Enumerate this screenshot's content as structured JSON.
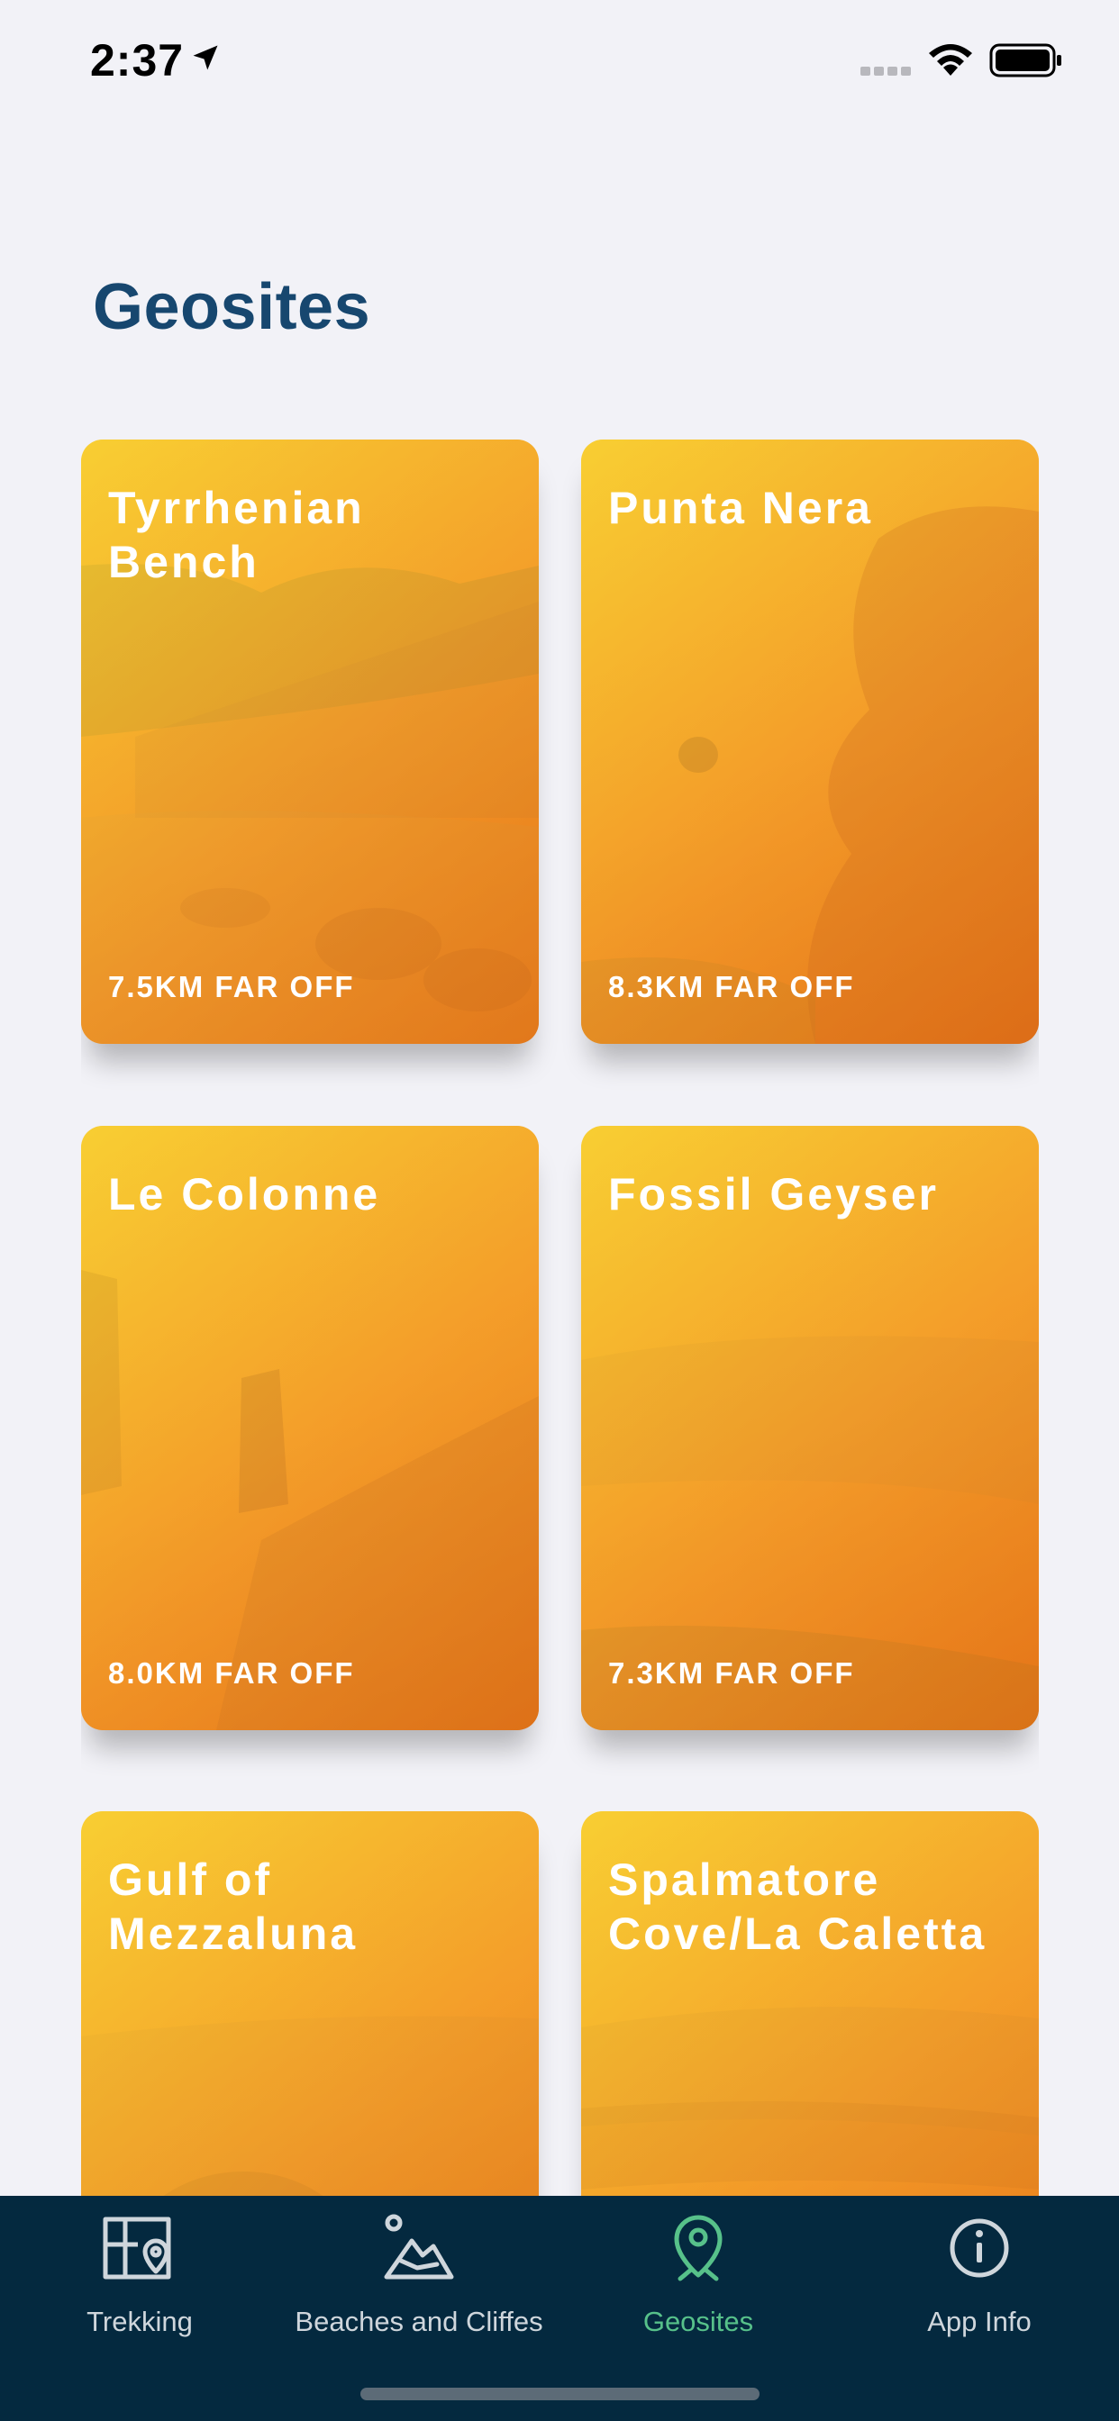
{
  "status_bar": {
    "time": "2:37"
  },
  "page": {
    "title": "Geosites"
  },
  "cards": [
    {
      "title": "Tyrrhenian Bench",
      "distance": "7.5KM FAR OFF"
    },
    {
      "title": "Punta Nera",
      "distance": "8.3KM FAR OFF"
    },
    {
      "title": "Le Colonne",
      "distance": "8.0KM FAR OFF"
    },
    {
      "title": "Fossil Geyser",
      "distance": "7.3KM FAR OFF"
    },
    {
      "title": "Gulf of Mezzaluna",
      "distance": ""
    },
    {
      "title": "Spalmatore Cove/La Caletta",
      "distance": ""
    }
  ],
  "tabs": [
    {
      "label": "Trekking",
      "icon": "map-pin-icon",
      "active": false
    },
    {
      "label": "Beaches and Cliffes",
      "icon": "beach-cliff-icon",
      "active": false
    },
    {
      "label": "Geosites",
      "icon": "geosite-pin-icon",
      "active": true
    },
    {
      "label": "App Info",
      "icon": "info-icon",
      "active": false
    }
  ],
  "colors": {
    "title": "#17476f",
    "tab_bar_bg": "#04293f",
    "tab_active": "#57c18a",
    "tab_inactive": "#cfd6dc",
    "card_gradient_start": "#fcd632",
    "card_gradient_end": "#e86e14"
  }
}
